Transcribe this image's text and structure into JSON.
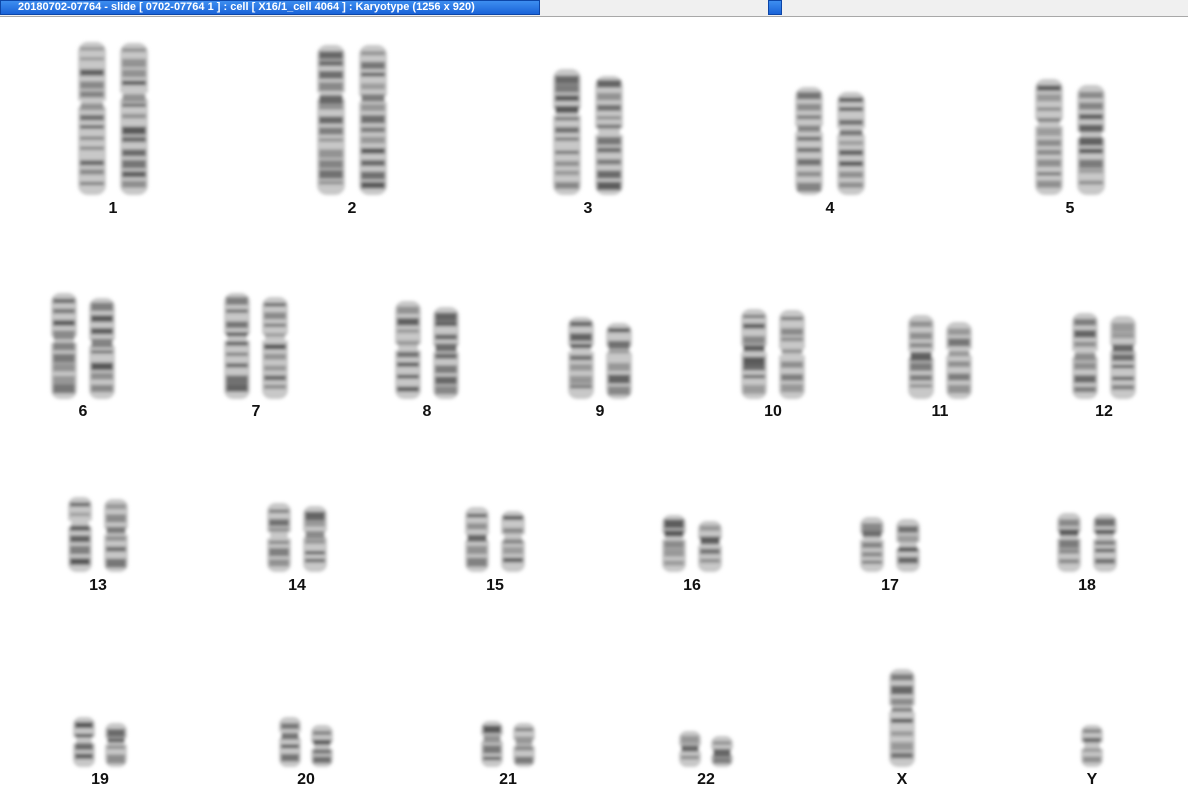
{
  "window": {
    "title": "20180702-07764 - slide [ 0702-07764 1 ] : cell [ X16/1_cell 4064 ] : Karyotype  (1256 x 920)"
  },
  "colors": {
    "title_bar": "#1a63d8",
    "chromatid_light": "#c8c8c8",
    "chromatid_dark": "#4a4a4a",
    "label": "#111111"
  },
  "chromosomes": [
    {
      "label": "1",
      "copies": 2
    },
    {
      "label": "2",
      "copies": 2
    },
    {
      "label": "3",
      "copies": 2
    },
    {
      "label": "4",
      "copies": 2
    },
    {
      "label": "5",
      "copies": 2
    },
    {
      "label": "6",
      "copies": 2
    },
    {
      "label": "7",
      "copies": 2
    },
    {
      "label": "8",
      "copies": 2
    },
    {
      "label": "9",
      "copies": 2
    },
    {
      "label": "10",
      "copies": 2
    },
    {
      "label": "11",
      "copies": 2
    },
    {
      "label": "12",
      "copies": 2
    },
    {
      "label": "13",
      "copies": 2
    },
    {
      "label": "14",
      "copies": 2
    },
    {
      "label": "15",
      "copies": 2
    },
    {
      "label": "16",
      "copies": 2
    },
    {
      "label": "17",
      "copies": 2
    },
    {
      "label": "18",
      "copies": 2
    },
    {
      "label": "19",
      "copies": 2
    },
    {
      "label": "20",
      "copies": 2
    },
    {
      "label": "21",
      "copies": 2
    },
    {
      "label": "22",
      "copies": 2
    },
    {
      "label": "X",
      "copies": 1
    },
    {
      "label": "Y",
      "copies": 1
    }
  ]
}
